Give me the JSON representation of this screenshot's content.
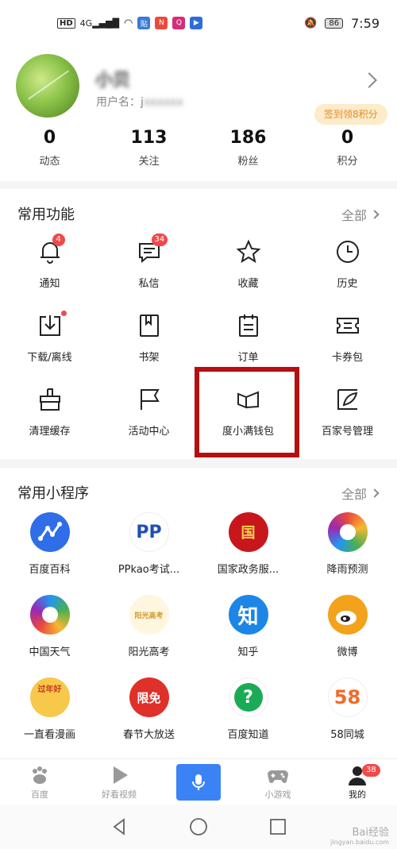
{
  "status_bar": {
    "hd": "HD",
    "network": "4G",
    "apps": [
      {
        "icon": "tieba-icon",
        "text": "贴",
        "color": "#3a7bd5"
      },
      {
        "icon": "news-icon",
        "text": "N",
        "color": "#e94b3c"
      },
      {
        "icon": "music-icon",
        "text": "Q",
        "color": "#d62c7a"
      },
      {
        "icon": "video-icon",
        "text": "▶",
        "color": "#2d6cdf"
      }
    ],
    "battery": "86",
    "time": "7:59"
  },
  "profile": {
    "username": "小贝",
    "userid_label": "用户名：j",
    "userid_hidden": "xxxxxx",
    "sign_badge": "签到领8积分",
    "stats": [
      {
        "value": "0",
        "label": "动态"
      },
      {
        "value": "113",
        "label": "关注"
      },
      {
        "value": "186",
        "label": "粉丝"
      },
      {
        "value": "0",
        "label": "积分"
      }
    ]
  },
  "functions": {
    "title": "常用功能",
    "more": "全部",
    "items": [
      {
        "label": "通知",
        "icon": "bell-icon",
        "badge": "4"
      },
      {
        "label": "私信",
        "icon": "message-icon",
        "badge": "34"
      },
      {
        "label": "收藏",
        "icon": "star-icon",
        "badge": ""
      },
      {
        "label": "历史",
        "icon": "clock-icon",
        "badge": ""
      },
      {
        "label": "下载/离线",
        "icon": "download-icon",
        "badge": "",
        "dot": true
      },
      {
        "label": "书架",
        "icon": "bookshelf-icon",
        "badge": ""
      },
      {
        "label": "订单",
        "icon": "order-icon",
        "badge": ""
      },
      {
        "label": "卡券包",
        "icon": "coupon-icon",
        "badge": ""
      },
      {
        "label": "清理缓存",
        "icon": "broom-icon",
        "badge": ""
      },
      {
        "label": "活动中心",
        "icon": "flag-icon",
        "badge": ""
      },
      {
        "label": "度小满钱包",
        "icon": "wallet-icon",
        "badge": ""
      },
      {
        "label": "百家号管理",
        "icon": "baijiahao-icon",
        "badge": ""
      }
    ]
  },
  "mini_programs": {
    "title": "常用小程序",
    "more": "全部",
    "items": [
      {
        "label": "百度百科",
        "icon": "baike-icon",
        "text": "",
        "color": "#2f6ee8"
      },
      {
        "label": "PPkao考试...",
        "icon": "ppkao-icon",
        "text": "PP",
        "color": "#ffffff"
      },
      {
        "label": "国家政务服...",
        "icon": "gov-icon",
        "text": "国",
        "color": "#c8161d"
      },
      {
        "label": "降雨预测",
        "icon": "rain-icon",
        "text": "",
        "color": "#ffffff"
      },
      {
        "label": "中国天气",
        "icon": "weather-icon",
        "text": "",
        "color": "#ffffff"
      },
      {
        "label": "阳光高考",
        "icon": "gaokao-icon",
        "text": "阳光高考",
        "color": "#fff6df"
      },
      {
        "label": "知乎",
        "icon": "zhihu-icon",
        "text": "知",
        "color": "#1b86e6"
      },
      {
        "label": "微博",
        "icon": "weibo-icon",
        "text": "",
        "color": "#f3a21b"
      },
      {
        "label": "一直看漫画",
        "icon": "manga-icon",
        "text": "过年好",
        "color": "#f8c84a"
      },
      {
        "label": "春节大放送",
        "icon": "spring-icon",
        "text": "限免",
        "color": "#e0302a"
      },
      {
        "label": "百度知道",
        "icon": "zhidao-icon",
        "text": "?",
        "color": "#1aab56"
      },
      {
        "label": "58同城",
        "icon": "58-icon",
        "text": "58",
        "color": "#ffffff"
      }
    ]
  },
  "tabbar": {
    "items": [
      {
        "label": "百度",
        "icon": "baidu-paw-icon"
      },
      {
        "label": "好看视频",
        "icon": "play-icon"
      },
      {
        "label": "",
        "icon": "microphone-icon"
      },
      {
        "label": "小游戏",
        "icon": "gamepad-icon"
      },
      {
        "label": "我的",
        "icon": "user-icon",
        "badge": "38"
      }
    ]
  },
  "watermark": {
    "text": "Bai经验",
    "url": "jingyan.baidu.com"
  }
}
